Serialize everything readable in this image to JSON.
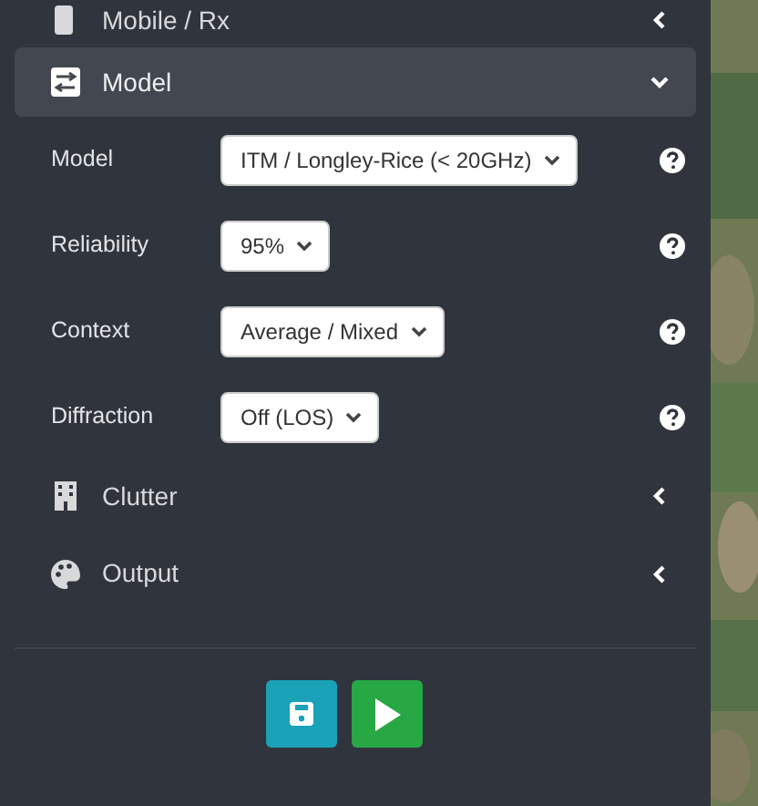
{
  "sidebar": {
    "sections": [
      {
        "title": "Mobile / Rx",
        "expanded": false
      },
      {
        "title": "Model",
        "expanded": true,
        "fields": [
          {
            "label": "Model",
            "value": "ITM / Longley-Rice (< 20GHz)"
          },
          {
            "label": "Reliability",
            "value": "95%"
          },
          {
            "label": "Context",
            "value": "Average / Mixed"
          },
          {
            "label": "Diffraction",
            "value": "Off (LOS)"
          }
        ]
      },
      {
        "title": "Clutter",
        "expanded": false
      },
      {
        "title": "Output",
        "expanded": false
      }
    ],
    "buttons": [
      {
        "kind": "save"
      },
      {
        "kind": "run"
      }
    ]
  }
}
